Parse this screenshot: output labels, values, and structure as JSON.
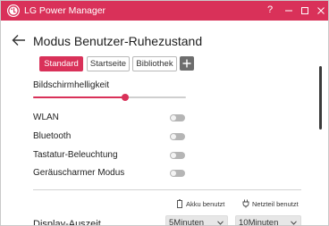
{
  "window": {
    "title": "LG Power Manager",
    "accent_color": "#d93159",
    "help_label": "?"
  },
  "page": {
    "title": "Modus Benutzer-Ruhezustand"
  },
  "profiles": {
    "tabs": [
      {
        "label": "Standard",
        "selected": true
      },
      {
        "label": "Startseite",
        "selected": false
      },
      {
        "label": "Bibliothek",
        "selected": false
      }
    ],
    "add_icon": "plus-icon"
  },
  "brightness": {
    "label": "Bildschirmhelligkeit",
    "value_fraction": 0.6
  },
  "toggles": [
    {
      "label": "WLAN",
      "on": false
    },
    {
      "label": "Bluetooth",
      "on": false
    },
    {
      "label": "Tastatur-Beleuchtung",
      "on": false
    },
    {
      "label": "Geräuscharmer Modus",
      "on": false
    }
  ],
  "power_columns": {
    "battery_label": "Akku benutzt",
    "battery_icon": "battery-icon",
    "adapter_label": "Netzteil benutzt",
    "adapter_icon": "plug-icon"
  },
  "display_timeout": {
    "label": "Display-Auszeit",
    "battery_value": "5Minuten",
    "adapter_value": "10Minuten"
  }
}
